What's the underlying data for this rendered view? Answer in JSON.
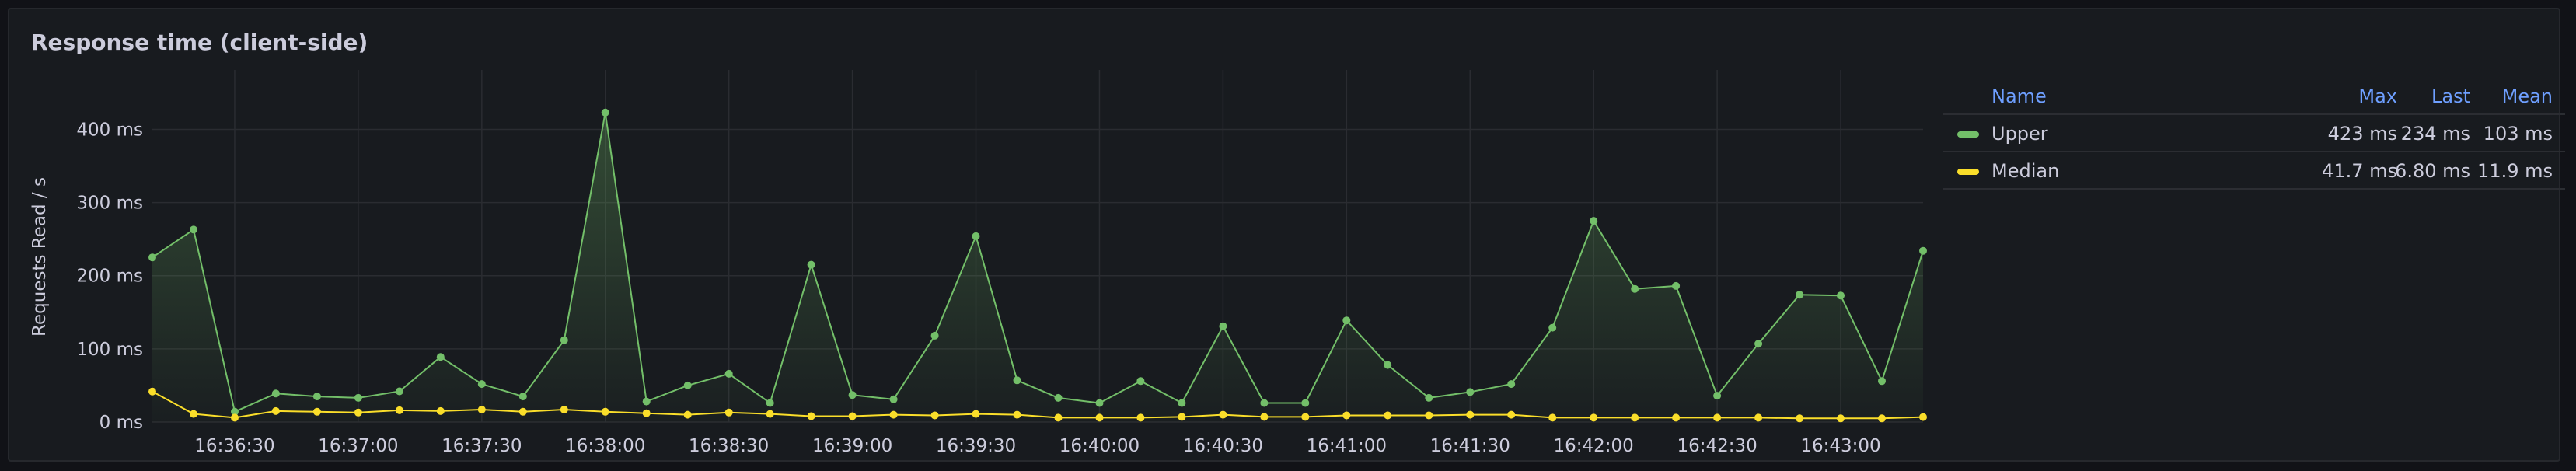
{
  "panel": {
    "title": "Response time (client-side)"
  },
  "legend": {
    "headers": {
      "name": "Name",
      "max": "Max",
      "last": "Last",
      "mean": "Mean"
    },
    "rows": [
      {
        "name": "Upper",
        "max": "423 ms",
        "last": "234 ms",
        "mean": "103 ms",
        "color": "#73bf69"
      },
      {
        "name": "Median",
        "max": "41.7 ms",
        "last": "6.80 ms",
        "mean": "11.9 ms",
        "color": "#fade2a"
      }
    ]
  },
  "chart_data": {
    "type": "line",
    "title": "Response time (client-side)",
    "xlabel": "",
    "ylabel": "Requests Read / s",
    "x": [
      "16:36:10",
      "16:36:20",
      "16:36:30",
      "16:36:40",
      "16:36:50",
      "16:37:00",
      "16:37:10",
      "16:37:20",
      "16:37:30",
      "16:37:40",
      "16:37:50",
      "16:38:00",
      "16:38:10",
      "16:38:20",
      "16:38:30",
      "16:38:40",
      "16:38:50",
      "16:39:00",
      "16:39:10",
      "16:39:20",
      "16:39:30",
      "16:39:40",
      "16:39:50",
      "16:40:00",
      "16:40:10",
      "16:40:20",
      "16:40:30",
      "16:40:40",
      "16:40:50",
      "16:41:00",
      "16:41:10",
      "16:41:20",
      "16:41:30",
      "16:41:40",
      "16:41:50",
      "16:42:00",
      "16:42:10",
      "16:42:20",
      "16:42:30",
      "16:42:40",
      "16:42:50",
      "16:43:00",
      "16:43:10",
      "16:43:20"
    ],
    "xticks": [
      "16:36:30",
      "16:37:00",
      "16:37:30",
      "16:38:00",
      "16:38:30",
      "16:39:00",
      "16:39:30",
      "16:40:00",
      "16:40:30",
      "16:41:00",
      "16:41:30",
      "16:42:00",
      "16:42:30",
      "16:43:00"
    ],
    "yticks": [
      {
        "value": 0,
        "label": "0 ms"
      },
      {
        "value": 100,
        "label": "100 ms"
      },
      {
        "value": 200,
        "label": "200 ms"
      },
      {
        "value": 300,
        "label": "300 ms"
      },
      {
        "value": 400,
        "label": "400 ms"
      }
    ],
    "ylim": [
      0,
      460
    ],
    "grid": true,
    "legend_placement": "right",
    "series": [
      {
        "name": "Upper",
        "color": "#73bf69",
        "values": [
          225,
          263,
          14,
          39,
          35,
          33,
          42,
          89,
          52,
          35,
          112,
          423,
          28,
          50,
          66,
          26,
          215,
          37,
          31,
          118,
          254,
          57,
          33,
          26,
          56,
          26,
          131,
          26,
          26,
          139,
          78,
          33,
          41,
          52,
          129,
          275,
          182,
          186,
          36,
          107,
          174,
          173,
          56,
          234
        ]
      },
      {
        "name": "Median",
        "color": "#fade2a",
        "values": [
          41.7,
          11,
          6,
          15,
          14,
          13,
          16,
          15,
          17,
          14,
          17,
          14,
          12,
          10,
          13,
          11,
          8,
          8,
          10,
          9,
          11,
          10,
          6,
          6,
          6,
          7,
          10,
          7,
          7,
          9,
          9,
          9,
          10,
          10,
          6,
          6,
          6,
          6,
          6,
          6,
          5,
          5,
          5,
          6.8
        ]
      }
    ]
  }
}
